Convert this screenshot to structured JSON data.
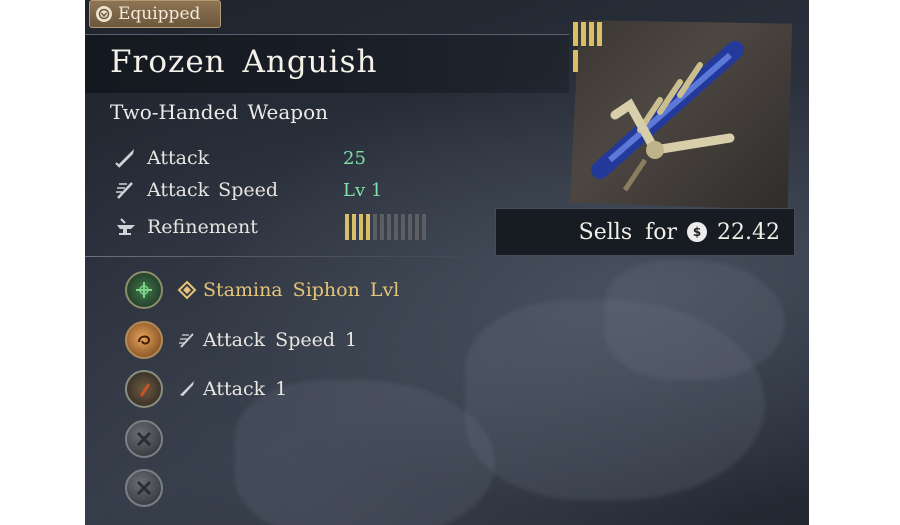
{
  "badge": {
    "label": "Equipped",
    "icon": "emblem-icon"
  },
  "item": {
    "name": "Frozen Anguish",
    "type": "Two-Handed Weapon"
  },
  "stats": [
    {
      "icon": "sword-icon",
      "label": "Attack",
      "value": "25"
    },
    {
      "icon": "attack-speed-icon",
      "label": "Attack Speed",
      "value": "Lv 1"
    },
    {
      "icon": "anvil-icon",
      "label": "Refinement",
      "value": ""
    }
  ],
  "refinement": {
    "filled": 4,
    "total": 12
  },
  "durability": {
    "filled_segments": 4
  },
  "sell": {
    "label": "Sells for",
    "value": "22.42",
    "currency_icon": "coin-icon"
  },
  "perks": [
    {
      "gem": "green-rune-gem",
      "icon": "diamond-rune-icon",
      "text": "Stamina Siphon Lvl",
      "highlight": true
    },
    {
      "gem": "amber-orb-gem",
      "icon": "attack-speed-icon",
      "text": "Attack Speed 1",
      "highlight": false
    },
    {
      "gem": "red-crystal-gem",
      "icon": "sword-icon",
      "text": "Attack 1",
      "highlight": false
    },
    {
      "gem": "empty-slot",
      "icon": "",
      "text": "",
      "highlight": false
    },
    {
      "gem": "empty-slot",
      "icon": "",
      "text": "",
      "highlight": false
    }
  ],
  "colors": {
    "accent_gold": "#d7be6a",
    "stat_green": "#7fe0a8",
    "perk_gold": "#e6c476"
  }
}
